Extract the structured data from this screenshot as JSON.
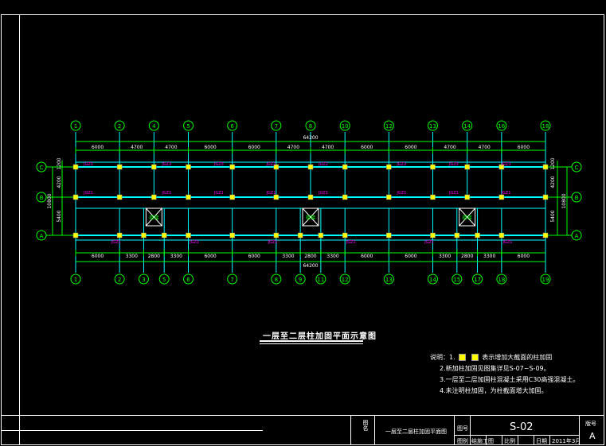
{
  "drawing": {
    "top_axes": [
      "1",
      "2",
      "4",
      "5",
      "6",
      "7",
      "8",
      "10",
      "12",
      "13",
      "14",
      "16",
      "18",
      "19"
    ],
    "bottom_axes": [
      "1",
      "2",
      "3",
      "5",
      "6",
      "7",
      "8",
      "9",
      "11",
      "12",
      "13",
      "14",
      "15",
      "17",
      "18",
      "19"
    ],
    "row_axes": [
      "C",
      "B",
      "A"
    ],
    "top_spans": [
      "6000",
      "4700",
      "4700",
      "6000",
      "6000",
      "4700",
      "4700",
      "6000",
      "6000",
      "4700",
      "4700",
      "6000"
    ],
    "bottom_spans": [
      "6000",
      "3300",
      "2800",
      "3300",
      "6000",
      "6000",
      "3300",
      "2800",
      "3300",
      "6000",
      "6000",
      "3300",
      "2800",
      "3300",
      "6000"
    ],
    "total_length": "64200",
    "left_dims": [
      "1200",
      "4200",
      "5400"
    ],
    "left_total": "10800",
    "right_dims": [
      "1200",
      "4200",
      "5400"
    ],
    "right_total": "10800",
    "column_tags_top": [
      "JGZ1",
      "JGZ2",
      "JGZ3",
      "JGZ1",
      "JGZ2",
      "JGZ2",
      "JGZ3",
      "JGZ3"
    ],
    "column_tags_mid": [
      "JGZ1",
      "JGZ1",
      "JGZ1",
      "JGZ1",
      "JGZ1",
      "JGZ1",
      "JGZ1",
      "JGZ1"
    ],
    "column_tags_bottom": [
      "JGZ1",
      "JGZ1",
      "JGZ1",
      "JGZ1",
      "JGZ1",
      "JGZ1"
    ],
    "stair_label": "楼梯"
  },
  "title": "一层至二层柱加固平面示意图",
  "notes": {
    "header": "说明：1.",
    "line1_text": "表示增加大截面的柱加固",
    "line2": "2.新加柱加固见图集详见S-07~S-09。",
    "line3": "3.一层至二层加固柱混凝土采用C30高强混凝土。",
    "line4": "4.未注明柱加固，为柱截面增大加固。"
  },
  "title_block": {
    "drawing_name_label": "图名",
    "drawing_name": "一层至二层柱加固平面图",
    "drawing_no_label": "图号",
    "drawing_no": "S-02",
    "category_label": "图别",
    "category": "结施工图",
    "scale_label": "比例",
    "date_label": "日期",
    "date": "2011年3月",
    "version_label": "版号",
    "version": "A"
  }
}
